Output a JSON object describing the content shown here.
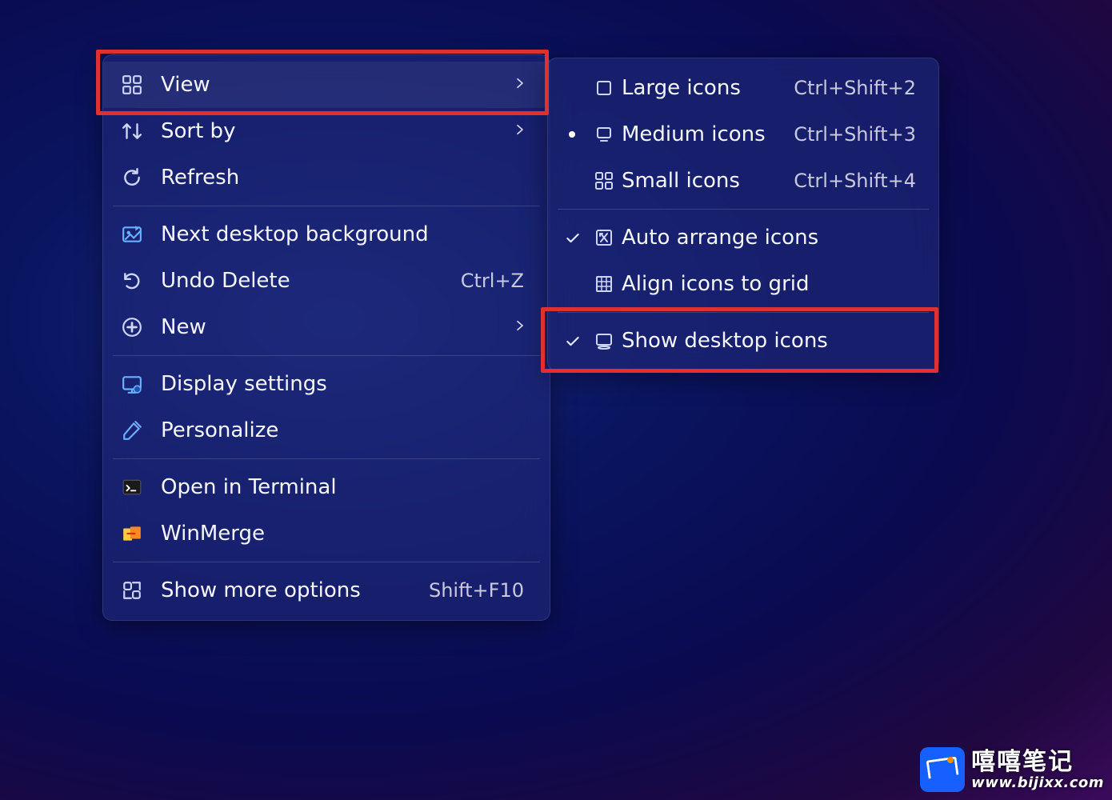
{
  "context_menu": {
    "groups": [
      [
        {
          "label": "View",
          "icon": "grid",
          "submenu": true
        },
        {
          "label": "Sort by",
          "icon": "sort",
          "submenu": true
        },
        {
          "label": "Refresh",
          "icon": "refresh"
        }
      ],
      [
        {
          "label": "Next desktop background",
          "icon": "picture-next"
        },
        {
          "label": "Undo Delete",
          "icon": "undo",
          "shortcut": "Ctrl+Z"
        },
        {
          "label": "New",
          "icon": "plus-circle",
          "submenu": true
        }
      ],
      [
        {
          "label": "Display settings",
          "icon": "display-gear"
        },
        {
          "label": "Personalize",
          "icon": "brush"
        }
      ],
      [
        {
          "label": "Open in Terminal",
          "icon": "terminal"
        },
        {
          "label": "WinMerge",
          "icon": "winmerge"
        }
      ],
      [
        {
          "label": "Show more options",
          "icon": "more",
          "shortcut": "Shift+F10"
        }
      ]
    ]
  },
  "submenu": {
    "groups": [
      [
        {
          "label": "Large icons",
          "icon": "large-icon",
          "shortcut": "Ctrl+Shift+2"
        },
        {
          "label": "Medium icons",
          "icon": "medium-icon",
          "shortcut": "Ctrl+Shift+3",
          "radio": true
        },
        {
          "label": "Small icons",
          "icon": "grid",
          "shortcut": "Ctrl+Shift+4"
        }
      ],
      [
        {
          "label": "Auto arrange icons",
          "icon": "auto-arrange",
          "checked": true
        },
        {
          "label": "Align icons to grid",
          "icon": "align-grid"
        }
      ],
      [
        {
          "label": "Show desktop icons",
          "icon": "desktop",
          "checked": true
        }
      ]
    ]
  },
  "watermark": {
    "title": "嘻嘻笔记",
    "url": "www.bijixx.com"
  }
}
